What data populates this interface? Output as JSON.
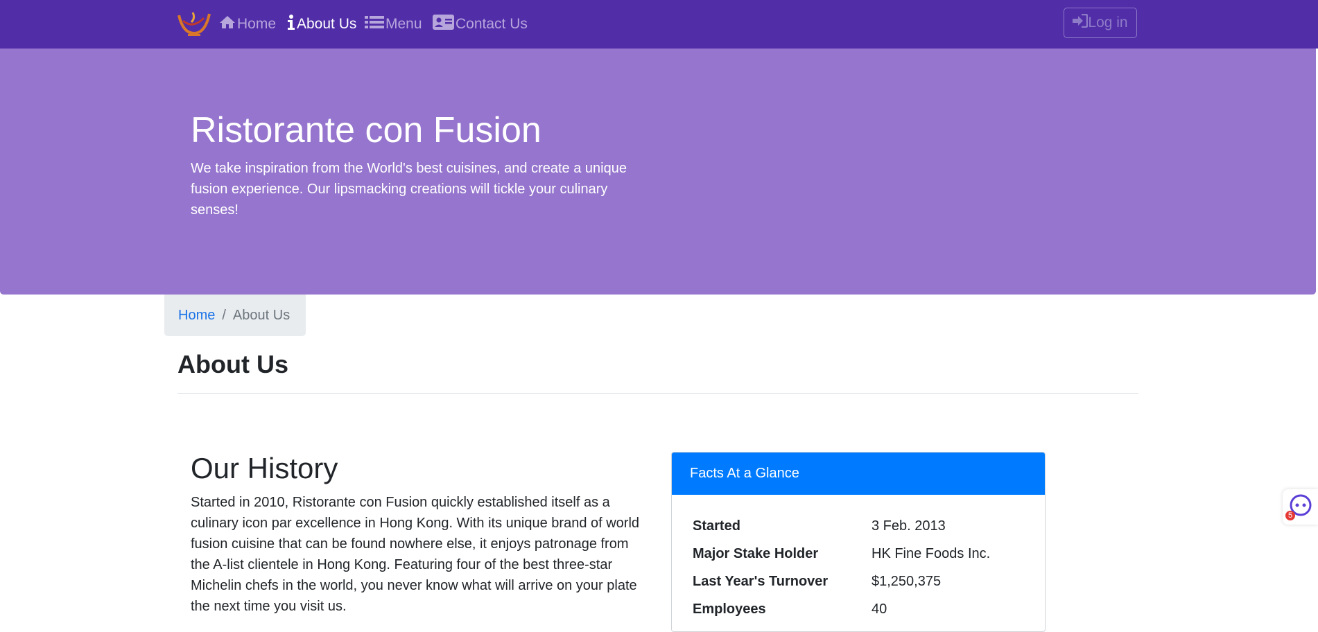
{
  "nav": {
    "items": [
      {
        "label": "Home",
        "icon": "home-icon"
      },
      {
        "label": "About Us",
        "icon": "info-icon"
      },
      {
        "label": "Menu",
        "icon": "list-icon"
      },
      {
        "label": "Contact Us",
        "icon": "address-card-icon"
      }
    ],
    "login_label": "Log in"
  },
  "jumbotron": {
    "title": "Ristorante con Fusion",
    "text": "We take inspiration from the World's best cuisines, and create a unique fusion experience. Our lipsmacking creations will tickle your culinary senses!"
  },
  "breadcrumb": {
    "home": "Home",
    "separator": "/",
    "current": "About Us"
  },
  "page": {
    "title": "About Us"
  },
  "history": {
    "title": "Our History",
    "text": "Started in 2010, Ristorante con Fusion quickly established itself as a culinary icon par excellence in Hong Kong. With its unique brand of world fusion cuisine that can be found nowhere else, it enjoys patronage from the A-list clientele in Hong Kong. Featuring four of the best three-star Michelin chefs in the world, you never know what will arrive on your plate the next time you visit us."
  },
  "facts": {
    "header": "Facts At a Glance",
    "rows": [
      {
        "label": "Started",
        "value": "3 Feb. 2013"
      },
      {
        "label": "Major Stake Holder",
        "value": "HK Fine Foods Inc."
      },
      {
        "label": "Last Year's Turnover",
        "value": "$1,250,375"
      },
      {
        "label": "Employees",
        "value": "40"
      }
    ]
  },
  "assistant": {
    "badge_count": "5"
  },
  "colors": {
    "navbar": "#512da8",
    "jumbotron": "#9575cd",
    "card_header": "#007bff",
    "link": "#1a73e8"
  }
}
